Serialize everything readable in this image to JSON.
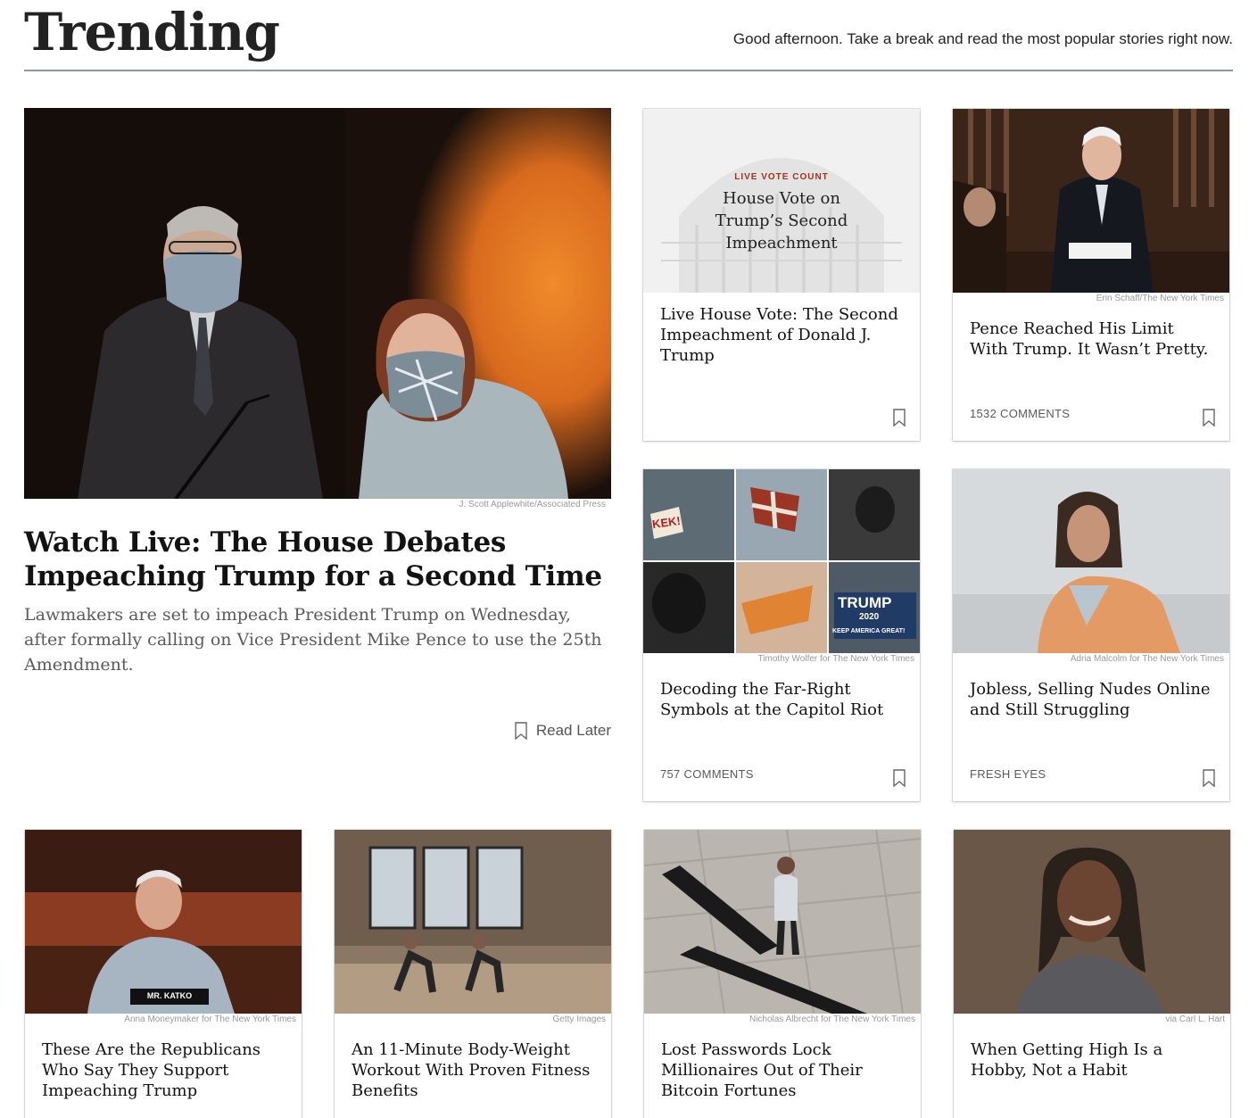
{
  "header": {
    "title": "Trending",
    "tagline": "Good afternoon. Take a break and read the most popular stories right now."
  },
  "hero": {
    "credit": "J. Scott Applewhite/Associated Press",
    "title": "Watch Live: The House Debates Impeaching Trump for a Second Time",
    "summary": "Lawmakers are set to impeach President Trump on Wednesday, after formally calling on Vice President Mike Pence to use the 25th Amendment.",
    "read_later": "Read Later"
  },
  "cards": [
    {
      "kicker": "LIVE VOTE COUNT",
      "graphic_title": "House Vote on Trump’s Second Impeachment",
      "credit": "",
      "title": "Live House Vote: The Second Impeachment of Donald J. Trump",
      "meta": ""
    },
    {
      "credit": "Erin Schaff/The New York Times",
      "title": "Pence Reached His Limit With Trump. It Wasn’t Pretty.",
      "meta": "1532 COMMENTS"
    },
    {
      "credit": "Timothy Wolfer for The New York Times",
      "title": "Decoding the Far-Right Symbols at the Capitol Riot",
      "meta": "757 COMMENTS",
      "sign_texts": [
        "KEK!",
        "TRUMP",
        "2020",
        "KEEP AMERICA GREAT!"
      ]
    },
    {
      "credit": "Adria Malcolm for The New York Times",
      "title": "Jobless, Selling Nudes Online and Still Struggling",
      "meta": "FRESH EYES"
    },
    {
      "credit": "Anna Moneymaker for The New York Times",
      "title": "These Are the Republicans Who Say They Support Impeaching Trump",
      "meta": "",
      "nameplate": "MR. KATKO"
    },
    {
      "credit": "Getty Images",
      "title": "An 11-Minute Body-Weight Workout With Proven Fitness Benefits",
      "meta": ""
    },
    {
      "credit": "Nicholas Albrecht for The New York Times",
      "title": "Lost Passwords Lock Millionaires Out of Their Bitcoin Fortunes",
      "meta": ""
    },
    {
      "credit": "via Carl L. Hart",
      "title": "When Getting High Is a Hobby, Not a Habit",
      "meta": ""
    }
  ],
  "icons": {
    "bookmark": "bookmark-icon"
  },
  "colors": {
    "accent_orange": "#e0751f",
    "kicker_red": "#a0341a",
    "rule": "#8a9a98"
  }
}
